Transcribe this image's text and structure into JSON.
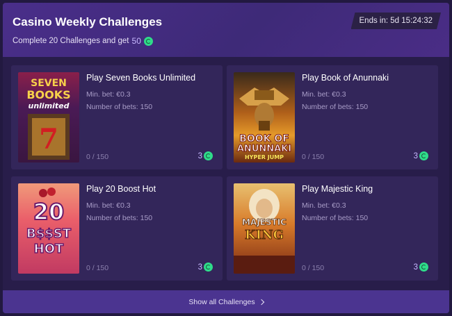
{
  "header": {
    "title": "Casino Weekly Challenges",
    "subtitle": "Complete 20 Challenges and get",
    "reward_amount": "50",
    "timer": "Ends in: 5d 15:24:32"
  },
  "challenges": [
    {
      "name": "Play Seven Books Unlimited",
      "min_bet": "Min. bet: €0.3",
      "num_bets": "Number of bets: 150",
      "progress": "0 / 150",
      "points": "3",
      "logo_lines": [
        "SEVEN",
        "BOOKS",
        "unlimited"
      ],
      "progress_fraction": 0
    },
    {
      "name": "Play Book of Anunnaki",
      "min_bet": "Min. bet: €0.3",
      "num_bets": "Number of bets: 150",
      "progress": "0 / 150",
      "points": "3",
      "logo_lines": [
        "BOOK OF",
        "ANUNNAKI",
        "HYPER JUMP"
      ],
      "progress_fraction": 0
    },
    {
      "name": "Play 20 Boost Hot",
      "min_bet": "Min. bet: €0.3",
      "num_bets": "Number of bets: 150",
      "progress": "0 / 150",
      "points": "3",
      "logo_lines": [
        "20",
        "B$$ST",
        "HOT"
      ],
      "progress_fraction": 0
    },
    {
      "name": "Play Majestic King",
      "min_bet": "Min. bet: €0.3",
      "num_bets": "Number of bets: 150",
      "progress": "0 / 150",
      "points": "3",
      "logo_lines": [
        "MAJESTIC",
        "KING"
      ],
      "progress_fraction": 0
    }
  ],
  "footer": {
    "show_all_label": "Show all Challenges"
  },
  "colors": {
    "background": "#221940",
    "card": "#33265a",
    "header_accent": "#4a2e8a",
    "coin": "#2fdc8a",
    "button": "#4b3490"
  },
  "icons": {
    "reward_coin": "coin-icon",
    "chevron": "chevron-right-icon"
  }
}
